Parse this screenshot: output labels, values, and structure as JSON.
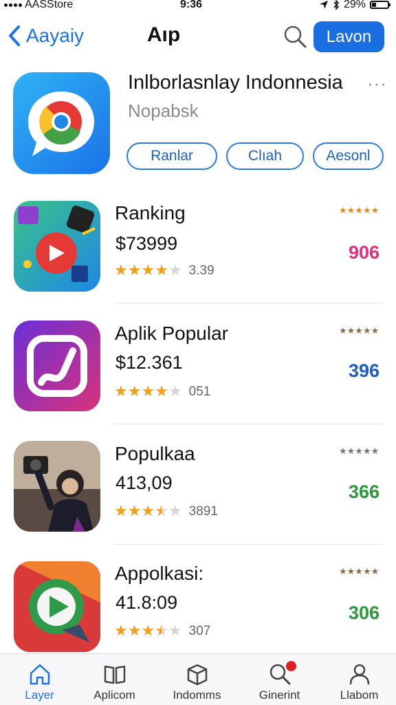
{
  "status_bar": {
    "carrier": "AASStore",
    "time": "9:36",
    "battery": "29%",
    "battery_level": 0.29
  },
  "nav": {
    "back_label": "Aayaiy",
    "title": "Aıp",
    "primary_button": "Lavon"
  },
  "featured": {
    "title": "Inlborlasnlay Indonnesia",
    "subtitle": "Nopabsk",
    "more": "···",
    "buttons": [
      "Ranlar",
      "Clıah",
      "Aesonl"
    ]
  },
  "apps": [
    {
      "name": "Ranking",
      "price": "$73999",
      "rating": 4,
      "rating_label": "3.39",
      "mini": "★★★★★",
      "mini_color": "#e8891c",
      "percent": "906",
      "percent_color": "#e0307a"
    },
    {
      "name": "Aplik Popular",
      "price": "$12.361",
      "rating": 4,
      "rating_label": "051",
      "mini": "★★★★★",
      "mini_color": "#8a6e46",
      "percent": "396",
      "percent_color": "#1a5fbf"
    },
    {
      "name": "Populkaa",
      "price": "413,09",
      "rating": 3.5,
      "rating_label": "3891",
      "mini": "★★★★★",
      "mini_color": "#777777",
      "percent": "366",
      "percent_color": "#2a9a3a"
    },
    {
      "name": "Appolkasi:",
      "price": "41.8:09",
      "rating": 3.5,
      "rating_label": "307",
      "mini": "★★★★★",
      "mini_color": "#8a6e46",
      "percent": "306",
      "percent_color": "#2a9a3a"
    }
  ],
  "tabs": [
    {
      "label": "Layer",
      "icon": "home-icon",
      "active": true
    },
    {
      "label": "Aplicom",
      "icon": "book-icon",
      "active": false
    },
    {
      "label": "Indomms",
      "icon": "box-icon",
      "active": false
    },
    {
      "label": "Ginerint",
      "icon": "search-icon",
      "active": false
    },
    {
      "label": "Llabom",
      "icon": "person-icon",
      "active": false
    }
  ],
  "colors": {
    "accent": "#1a73e8",
    "star": "#f0a020",
    "star_empty": "#d5d5d5"
  }
}
